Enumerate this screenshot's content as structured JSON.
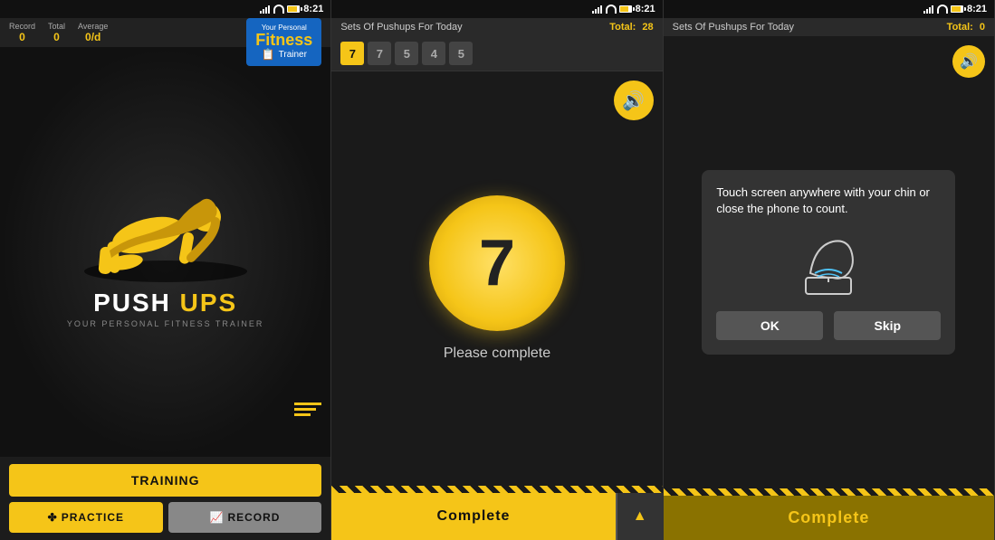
{
  "statusBar": {
    "time": "8:21"
  },
  "screen1": {
    "stats": {
      "record_label": "Record",
      "record_value": "0",
      "total_label": "Total",
      "total_value": "0",
      "average_label": "Average",
      "average_value": "0/d"
    },
    "badge": {
      "your_personal": "Your Personal",
      "fitness": "Fitness",
      "trainer": "Trainer"
    },
    "title_push": "PUSH ",
    "title_ups": "UPS",
    "subtitle": "YOUR PERSONAL FITNESS TRAINER",
    "btn_training": "TRAINING",
    "btn_practice": "PRACTICE",
    "btn_record": "RECORD"
  },
  "screen2": {
    "header_label": "Sets Of Pushups For Today",
    "total_label": "Total:",
    "total_value": "28",
    "sets": [
      {
        "value": "7",
        "active": true
      },
      {
        "value": "7",
        "active": false
      },
      {
        "value": "5",
        "active": false
      },
      {
        "value": "4",
        "active": false
      },
      {
        "value": "5",
        "active": false
      }
    ],
    "counter": "7",
    "please_complete": "Please complete",
    "btn_complete": "Complete"
  },
  "screen3": {
    "header_label": "Sets Of Pushups For Today",
    "total_label": "Total:",
    "total_value": "0",
    "dialog_text": "Touch screen anywhere with your chin or close the phone to count.",
    "btn_ok": "OK",
    "btn_skip": "Skip",
    "btn_complete": "Complete"
  }
}
